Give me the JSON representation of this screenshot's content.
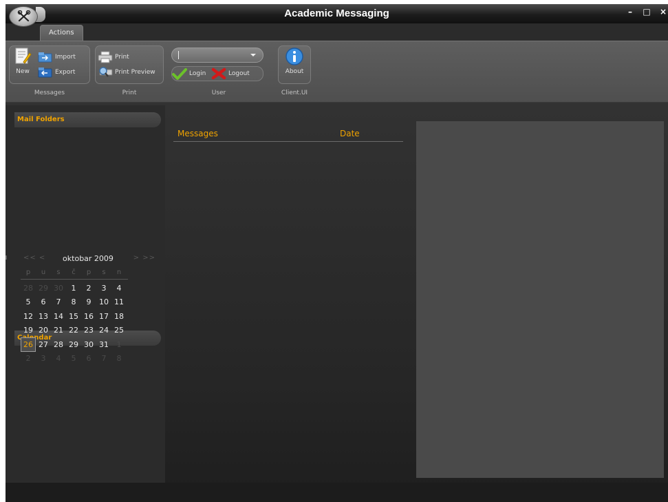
{
  "window": {
    "title": "Academic Messaging",
    "controls": [
      "minimize-icon",
      "maximize-icon",
      "close-icon"
    ]
  },
  "tabs": [
    {
      "label": "Actions",
      "selected": true
    }
  ],
  "ribbon": {
    "groups": {
      "messages": {
        "label": "Messages",
        "new_label": "New",
        "import_label": "Import",
        "export_label": "Export"
      },
      "print": {
        "label": "Print",
        "print_label": "Print",
        "preview_label": "Print Preview"
      },
      "user": {
        "label": "User",
        "combo_value": "",
        "login_label": "Login",
        "logout_label": "Logout"
      },
      "client": {
        "label": "Client.UI",
        "about_label": "About"
      }
    }
  },
  "sidebar": {
    "mail_folders_title": "Mail Folders",
    "calendar_title": "Calendar"
  },
  "calendar": {
    "month_label": "oktobar 2009",
    "prev_label": "<< <",
    "next_label": "> >>",
    "weekdays": [
      "p",
      "u",
      "s",
      "č",
      "p",
      "s",
      "n"
    ],
    "days": [
      {
        "d": "28",
        "dim": true
      },
      {
        "d": "29",
        "dim": true
      },
      {
        "d": "30",
        "dim": true
      },
      {
        "d": "1"
      },
      {
        "d": "2"
      },
      {
        "d": "3"
      },
      {
        "d": "4"
      },
      {
        "d": "5"
      },
      {
        "d": "6"
      },
      {
        "d": "7"
      },
      {
        "d": "8"
      },
      {
        "d": "9"
      },
      {
        "d": "10"
      },
      {
        "d": "11"
      },
      {
        "d": "12"
      },
      {
        "d": "13"
      },
      {
        "d": "14"
      },
      {
        "d": "15"
      },
      {
        "d": "16"
      },
      {
        "d": "17"
      },
      {
        "d": "18"
      },
      {
        "d": "19"
      },
      {
        "d": "20"
      },
      {
        "d": "21"
      },
      {
        "d": "22"
      },
      {
        "d": "23"
      },
      {
        "d": "24"
      },
      {
        "d": "25"
      },
      {
        "d": "26",
        "today": true
      },
      {
        "d": "27"
      },
      {
        "d": "28"
      },
      {
        "d": "29"
      },
      {
        "d": "30"
      },
      {
        "d": "31"
      },
      {
        "d": "1",
        "dim": true
      },
      {
        "d": "2",
        "dim": true
      },
      {
        "d": "3",
        "dim": true
      },
      {
        "d": "4",
        "dim": true
      },
      {
        "d": "5",
        "dim": true
      },
      {
        "d": "6",
        "dim": true
      },
      {
        "d": "7",
        "dim": true
      },
      {
        "d": "8",
        "dim": true
      }
    ]
  },
  "messages": {
    "columns": {
      "messages": "Messages",
      "date": "Date"
    },
    "rows": []
  },
  "colors": {
    "accent": "#f0a300",
    "background": "#2b2b2b",
    "preview_panel": "#4a4a4a"
  }
}
